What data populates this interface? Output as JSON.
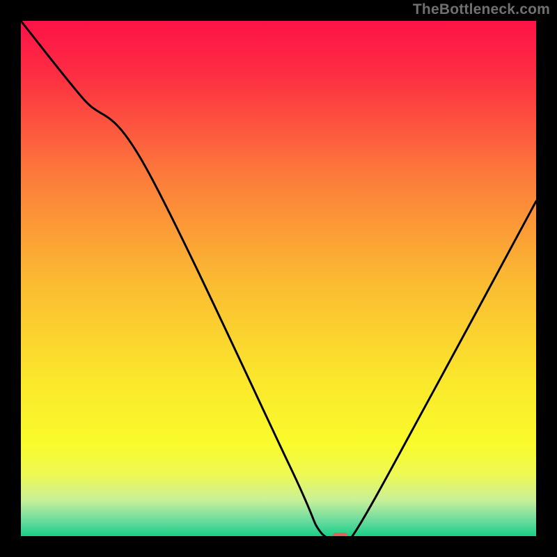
{
  "watermark": "TheBottleneck.com",
  "chart_data": {
    "type": "line",
    "title": "",
    "xlabel": "",
    "ylabel": "",
    "xlim": [
      0,
      100
    ],
    "ylim": [
      0,
      100
    ],
    "grid": false,
    "series": [
      {
        "name": "bottleneck-curve",
        "x": [
          0,
          12,
          24,
          52,
          58,
          62,
          65,
          80,
          100
        ],
        "y": [
          100,
          85,
          72,
          14,
          1,
          0,
          1,
          28,
          65
        ]
      }
    ],
    "marker": {
      "name": "optimal-point",
      "x": 62,
      "y": 0,
      "color": "#d9675f"
    },
    "background_gradient": {
      "stops": [
        {
          "offset": 0.0,
          "color": "#fd1347"
        },
        {
          "offset": 0.1,
          "color": "#fd2c43"
        },
        {
          "offset": 0.3,
          "color": "#fc7b3b"
        },
        {
          "offset": 0.5,
          "color": "#fbb932"
        },
        {
          "offset": 0.7,
          "color": "#fbe82c"
        },
        {
          "offset": 0.82,
          "color": "#f9fb2b"
        },
        {
          "offset": 0.88,
          "color": "#eef953"
        },
        {
          "offset": 0.93,
          "color": "#c9f098"
        },
        {
          "offset": 0.97,
          "color": "#6adb9e"
        },
        {
          "offset": 1.0,
          "color": "#19cf86"
        }
      ]
    }
  }
}
